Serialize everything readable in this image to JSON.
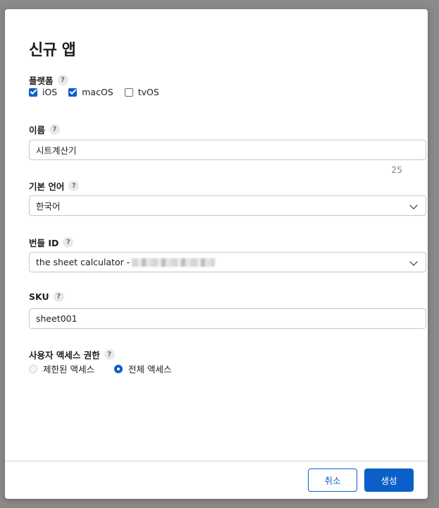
{
  "dialog": {
    "title": "신규 앱",
    "help_glyph": "?",
    "platforms": {
      "label": "플랫폼",
      "options": [
        {
          "label": "iOS",
          "checked": true
        },
        {
          "label": "macOS",
          "checked": true
        },
        {
          "label": "tvOS",
          "checked": false
        }
      ]
    },
    "name": {
      "label": "이름",
      "value": "시트계산기",
      "counter": "25"
    },
    "primary_language": {
      "label": "기본 언어",
      "value": "한국어"
    },
    "bundle_id": {
      "label": "번들 ID",
      "value": "the sheet calculator -"
    },
    "sku": {
      "label": "SKU",
      "value": "sheet001"
    },
    "user_access": {
      "label": "사용자 액세스 권한",
      "options": [
        {
          "label": "제한된 액세스",
          "selected": false
        },
        {
          "label": "전체 액세스",
          "selected": true
        }
      ]
    },
    "buttons": {
      "cancel": "취소",
      "create": "생성"
    }
  },
  "colors": {
    "accent": "#0a60c8",
    "overlay": "#8a8a8a"
  }
}
